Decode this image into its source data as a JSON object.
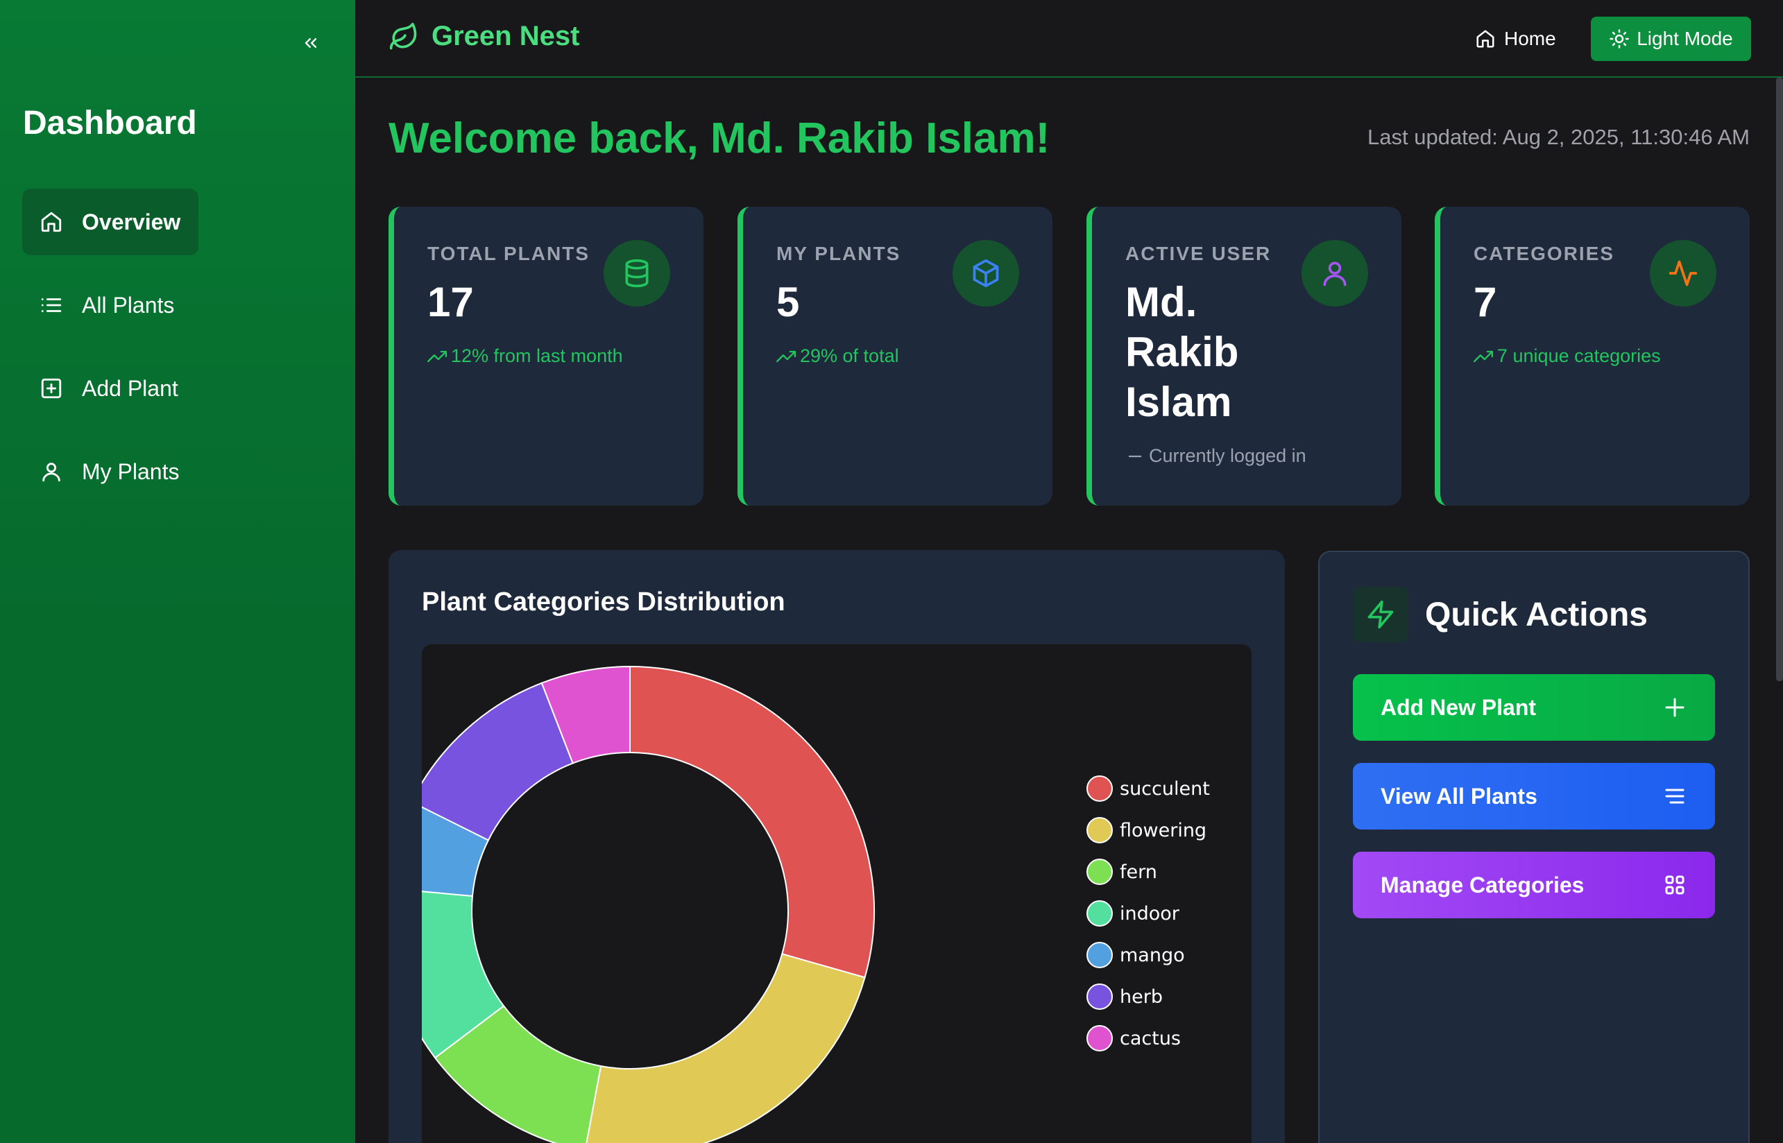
{
  "sidebar": {
    "title": "Dashboard",
    "items": [
      {
        "label": "Overview",
        "icon": "home-icon",
        "active": true
      },
      {
        "label": "All Plants",
        "icon": "list-icon"
      },
      {
        "label": "Add Plant",
        "icon": "plus-square-icon"
      },
      {
        "label": "My Plants",
        "icon": "user-icon"
      }
    ]
  },
  "header": {
    "brand": "Green Nest",
    "home_label": "Home",
    "mode_label": "Light Mode"
  },
  "main": {
    "welcome": "Welcome back, Md. Rakib Islam!",
    "last_updated": "Last updated: Aug 2, 2025, 11:30:46 AM",
    "stats": [
      {
        "label": "TOTAL PLANTS",
        "value": "17",
        "sub": "12% from last month",
        "icon": "database-icon"
      },
      {
        "label": "MY PLANTS",
        "value": "5",
        "sub": "29% of total",
        "icon": "cube-icon"
      },
      {
        "label": "ACTIVE USER",
        "value": "Md. Rakib Islam",
        "sub": "Currently logged in",
        "icon": "user-icon"
      },
      {
        "label": "CATEGORIES",
        "value": "7",
        "sub": "7 unique categories",
        "icon": "activity-icon"
      }
    ]
  },
  "chart": {
    "title": "Plant Categories Distribution"
  },
  "chart_data": {
    "type": "pie",
    "style": "doughnut",
    "categories": [
      "succulent",
      "flowering",
      "fern",
      "indoor",
      "mango",
      "herb",
      "cactus"
    ],
    "values": [
      5,
      4,
      2,
      2,
      1,
      2,
      1
    ],
    "colors": [
      "#e05353",
      "#e0c954",
      "#7de053",
      "#53e09e",
      "#53a0e0",
      "#7853e0",
      "#e053d0"
    ],
    "legend_position": "right"
  },
  "quick_actions": {
    "title": "Quick Actions",
    "buttons": [
      {
        "label": "Add New Plant",
        "icon": "plus-icon"
      },
      {
        "label": "View All Plants",
        "icon": "menu-icon"
      },
      {
        "label": "Manage Categories",
        "icon": "grid-icon"
      }
    ]
  },
  "colors": {
    "accent": "#22c55e",
    "sidebar": "#087a34",
    "card": "#1e293b",
    "background": "#18181b"
  }
}
